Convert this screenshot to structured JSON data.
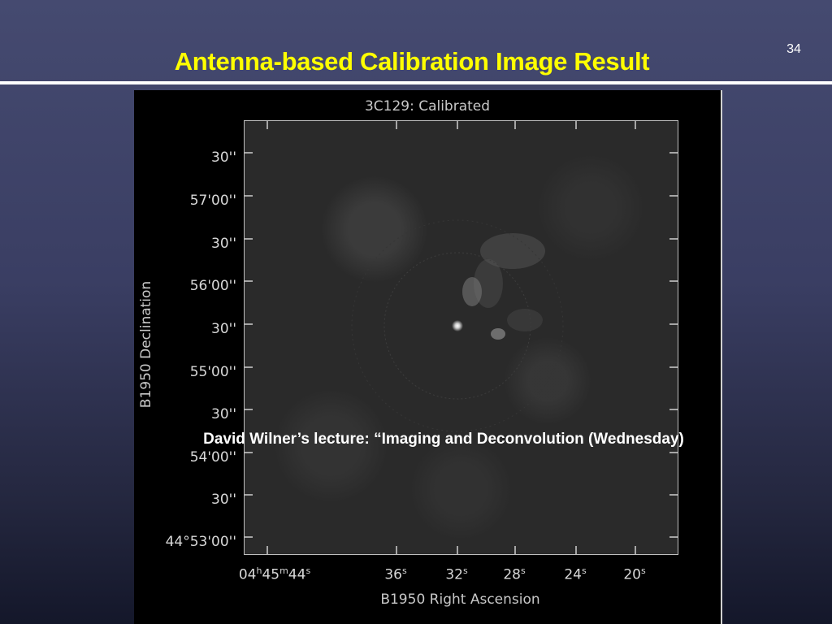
{
  "slide": {
    "number": "34",
    "title": "Antenna-based Calibration Image Result",
    "caption": "David Wilner’s lecture: “Imaging and Deconvolution (Wednesday)"
  },
  "figure": {
    "title": "3C129: Calibrated",
    "ylabel": "B1950 Declination",
    "xlabel": "B1950 Right Ascension",
    "y_ticks": [
      "30''",
      "57'00''",
      "30''",
      "56'00''",
      "30''",
      "55'00''",
      "30''",
      "54'00''",
      "30''",
      "44°53'00''"
    ],
    "x_ticks": [
      {
        "main": "04",
        "sup1": "h",
        "mid": "45",
        "sup2": "m",
        "end": "44",
        "sup3": "s"
      },
      {
        "main": "36",
        "sup3": "s"
      },
      {
        "main": "32",
        "sup3": "s"
      },
      {
        "main": "28",
        "sup3": "s"
      },
      {
        "main": "24",
        "sup3": "s"
      },
      {
        "main": "20",
        "sup3": "s"
      }
    ]
  },
  "colors": {
    "title": "#ffff00",
    "rule": "#ffffff",
    "caption": "#ffffff",
    "plot_background": "#000000"
  }
}
